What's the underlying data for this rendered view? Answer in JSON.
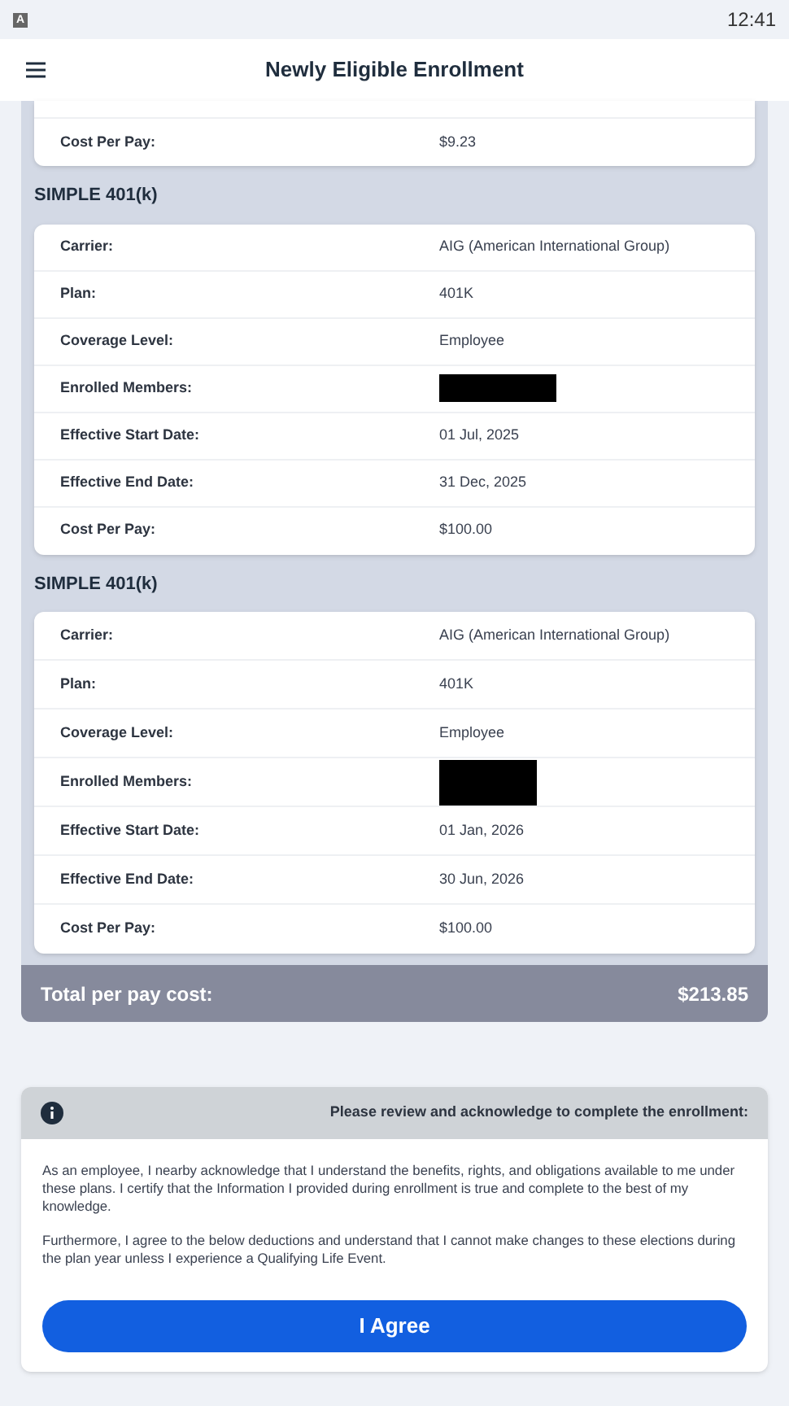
{
  "status_bar": {
    "app_badge": "A",
    "time": "12:41"
  },
  "header": {
    "title": "Newly Eligible Enrollment"
  },
  "top_card": {
    "rows": [
      {
        "kind": "text",
        "label": "Cost Per Pay:",
        "value": "$9.23"
      }
    ]
  },
  "plans": [
    {
      "title": "SIMPLE 401(k)",
      "rows": [
        {
          "kind": "text",
          "label": "Carrier:",
          "value": "AIG (American International Group)"
        },
        {
          "kind": "text",
          "label": "Plan:",
          "value": "401K"
        },
        {
          "kind": "text",
          "label": "Coverage Level:",
          "value": "Employee"
        },
        {
          "kind": "redacted",
          "label": "Enrolled Members:"
        },
        {
          "kind": "text",
          "label": "Effective Start Date:",
          "value": "01 Jul, 2025"
        },
        {
          "kind": "text",
          "label": "Effective End Date:",
          "value": "31 Dec, 2025"
        },
        {
          "kind": "text",
          "label": "Cost Per Pay:",
          "value": "$100.00"
        }
      ]
    },
    {
      "title": "SIMPLE 401(k)",
      "rows": [
        {
          "kind": "text",
          "label": "Carrier:",
          "value": "AIG (American International Group)"
        },
        {
          "kind": "text",
          "label": "Plan:",
          "value": "401K"
        },
        {
          "kind": "text",
          "label": "Coverage Level:",
          "value": "Employee"
        },
        {
          "kind": "redacted",
          "label": "Enrolled Members:"
        },
        {
          "kind": "text",
          "label": "Effective Start Date:",
          "value": "01 Jan, 2026"
        },
        {
          "kind": "text",
          "label": "Effective End Date:",
          "value": "30 Jun, 2026"
        },
        {
          "kind": "text",
          "label": "Cost Per Pay:",
          "value": "$100.00"
        }
      ]
    }
  ],
  "total": {
    "label": "Total per pay cost:",
    "value": "$213.85"
  },
  "acknowledgement": {
    "heading": "Please review and acknowledge to complete the enrollment:",
    "paragraphs": [
      "As an employee, I nearby acknowledge that I understand the benefits, rights, and obligations available to me under these plans. I certify that the Information I provided during enrollment is true and complete to the best of my knowledge.",
      "Furthermore, I agree to the below deductions and understand that I cannot make changes to these elections during the plan year unless I experience a Qualifying Life Event."
    ],
    "button": "I Agree"
  }
}
